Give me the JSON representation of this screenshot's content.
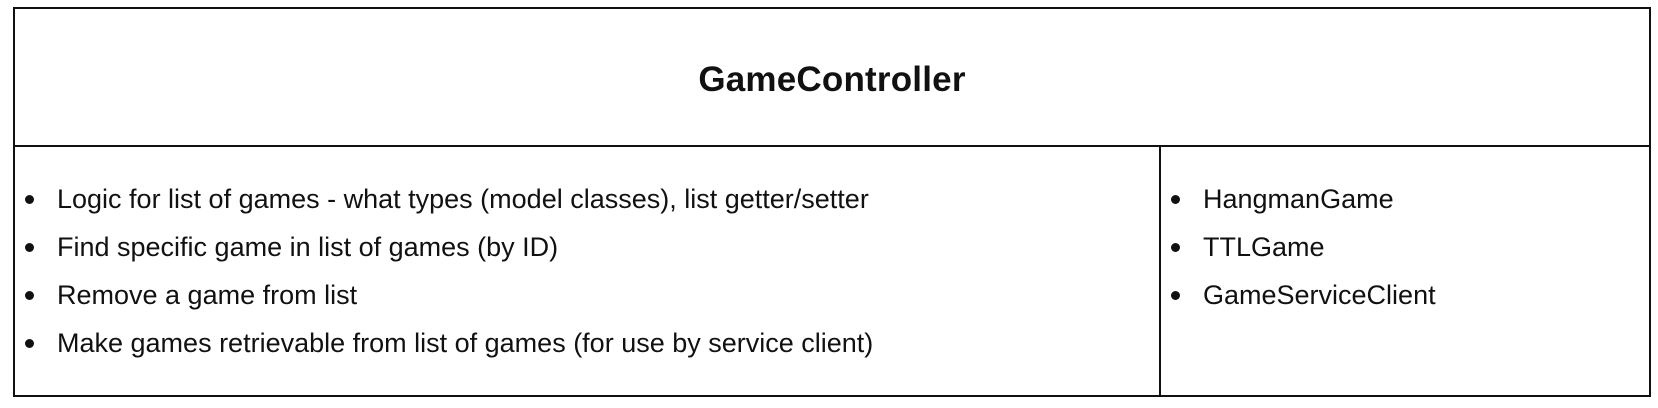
{
  "card": {
    "title": "GameController",
    "responsibilities": [
      "Logic for list of games - what types (model classes), list getter/setter",
      "Find specific game in list of games (by ID)",
      "Remove a game from list",
      "Make games retrievable from list of games (for use by service client)"
    ],
    "collaborators": [
      "HangmanGame",
      "TTLGame",
      "GameServiceClient"
    ]
  }
}
